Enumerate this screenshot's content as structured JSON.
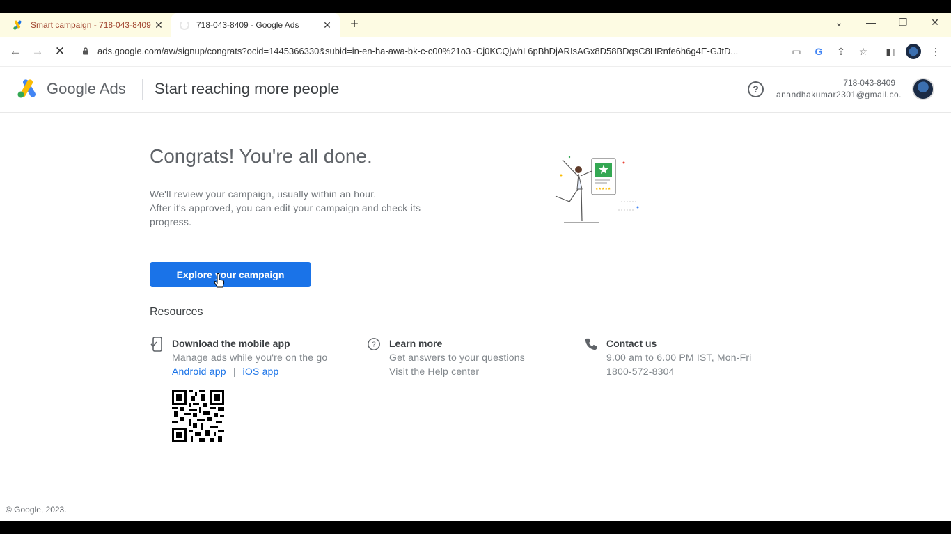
{
  "browser": {
    "tabs": [
      {
        "title": "Smart campaign - 718-043-8409",
        "icon": "google-ads-favicon"
      },
      {
        "title": "718-043-8409 - Google Ads",
        "icon": "loading-spinner"
      }
    ],
    "new_tab_symbol": "+",
    "close_symbol": "✕",
    "url": "ads.google.com/aw/signup/congrats?ocid=1445366330&subid=in-en-ha-awa-bk-c-c00%21o3~Cj0KCQjwhL6pBhDjARIsAGx8D58BDqsC8HRnfe6h6g4E-GJtD..."
  },
  "header": {
    "brand": "Google Ads",
    "page_title": "Start reaching more people",
    "help_symbol": "?",
    "account_number": "718-043-8409",
    "account_email": "anandhakumar2301@gmail.co..."
  },
  "main": {
    "heading": "Congrats! You're all done.",
    "message_line1": "We'll review your campaign, usually within an hour.",
    "message_line2": "After it's approved, you can edit your campaign and check its progress.",
    "cta_label": "Explore your campaign",
    "resources_title": "Resources"
  },
  "resources": {
    "mobile": {
      "title": "Download the mobile app",
      "desc": "Manage ads while you're on the go",
      "android": "Android app",
      "separator": "|",
      "ios": "iOS app"
    },
    "learn": {
      "title": "Learn more",
      "desc": "Get answers to your questions",
      "link": "Visit the Help center"
    },
    "contact": {
      "title": "Contact us",
      "hours": "9.00 am to 6.00 PM IST, Mon-Fri",
      "phone": "1800-572-8304"
    }
  },
  "footer": {
    "copyright": "© Google, 2023."
  },
  "colors": {
    "accent": "#1a73e8",
    "tabbar": "#fdfbe3"
  }
}
